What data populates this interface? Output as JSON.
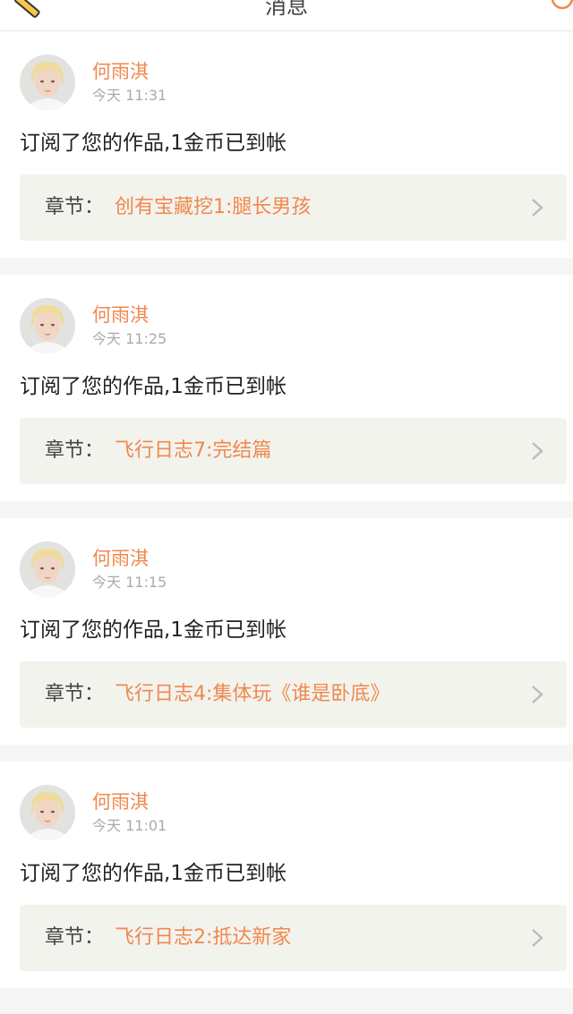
{
  "header": {
    "title": "消息",
    "left_icon": "edit-icon",
    "right_icon": "search-icon"
  },
  "messages": [
    {
      "avatar_icon": "user-avatar",
      "user": "何雨淇",
      "time": "今天 11:31",
      "text": "订阅了您的作品,1金币已到帐",
      "chapter_prefix": "章节：",
      "chapter_title": "创有宝藏挖1:腿长男孩"
    },
    {
      "avatar_icon": "user-avatar",
      "user": "何雨淇",
      "time": "今天 11:25",
      "text": "订阅了您的作品,1金币已到帐",
      "chapter_prefix": "章节：",
      "chapter_title": "飞行日志7:完结篇"
    },
    {
      "avatar_icon": "user-avatar",
      "user": "何雨淇",
      "time": "今天 11:15",
      "text": "订阅了您的作品,1金币已到帐",
      "chapter_prefix": "章节：",
      "chapter_title": "飞行日志4:集体玩《谁是卧底》"
    },
    {
      "avatar_icon": "user-avatar",
      "user": "何雨淇",
      "time": "今天 11:01",
      "text": "订阅了您的作品,1金币已到帐",
      "chapter_prefix": "章节：",
      "chapter_title": "飞行日志2:抵达新家"
    }
  ],
  "colors": {
    "accent": "#f0884d",
    "chapter_bg": "#f3f3ee",
    "page_bg": "#f6f6f6"
  }
}
